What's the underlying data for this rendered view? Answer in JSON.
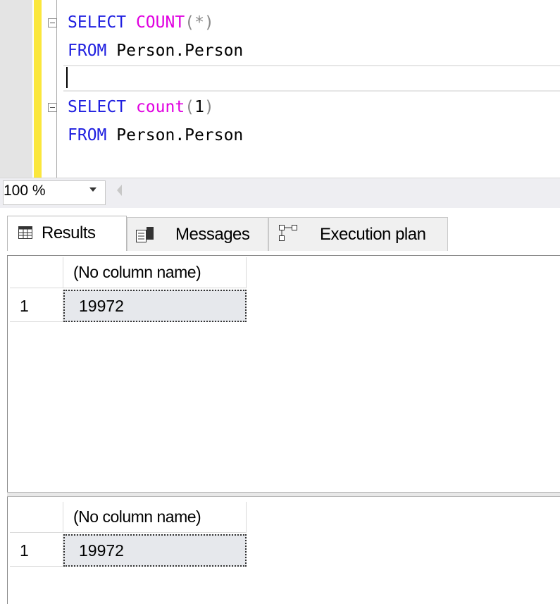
{
  "editor": {
    "lines": [
      {
        "keyword": "SELECT",
        "func": "COUNT",
        "open": "(",
        "arg": "*",
        "close": ")"
      },
      {
        "keyword": "FROM",
        "object": "Person.Person"
      },
      {
        "keyword": "SELECT",
        "func": "count",
        "open": "(",
        "arg": "1",
        "close": ")"
      },
      {
        "keyword": "FROM",
        "object": "Person.Person"
      }
    ]
  },
  "zoom": {
    "value": "100 %"
  },
  "tabs": [
    {
      "label": "Results",
      "icon": "grid-icon"
    },
    {
      "label": "Messages",
      "icon": "messages-icon"
    },
    {
      "label": "Execution plan",
      "icon": "execution-plan-icon"
    }
  ],
  "result_sets": [
    {
      "columns": [
        "(No column name)"
      ],
      "rows": [
        {
          "num": "1",
          "value": "19972"
        }
      ]
    },
    {
      "columns": [
        "(No column name)"
      ],
      "rows": [
        {
          "num": "1",
          "value": "19972"
        }
      ]
    }
  ],
  "colors": {
    "keyword": "#1f1fe0",
    "function": "#e000e0",
    "change_bar": "#fbe73c"
  }
}
